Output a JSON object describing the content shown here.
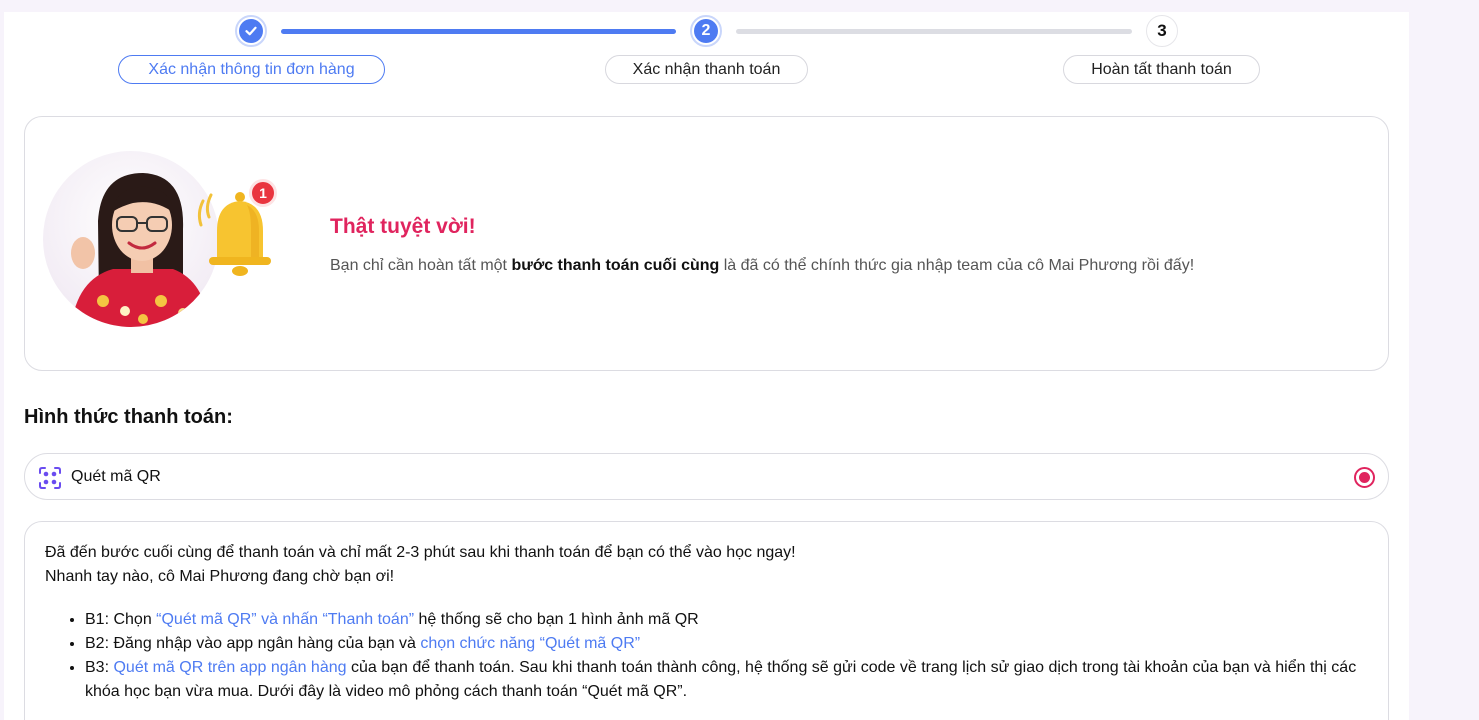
{
  "stepper": {
    "steps": [
      {
        "label": "Xác nhận thông tin đơn hàng",
        "state": "done"
      },
      {
        "label": "Xác nhận thanh toán",
        "number": "2",
        "state": "active"
      },
      {
        "label": "Hoàn tất thanh toán",
        "number": "3",
        "state": "todo"
      }
    ]
  },
  "hero": {
    "title": "Thật tuyệt vời!",
    "text_before": "Bạn chỉ cần hoàn tất một ",
    "text_bold": "bước thanh toán cuối cùng",
    "text_after": " là đã có thể chính thức gia nhập team của cô Mai Phương rồi đấy!",
    "notification_count": "1"
  },
  "payment": {
    "section_title": "Hình thức thanh toán:",
    "method_label": "Quét mã QR",
    "selected": true
  },
  "instructions": {
    "line1": "Đã đến bước cuối cùng để thanh toán và chỉ mất 2-3 phút sau khi thanh toán để bạn có thể vào học ngay!",
    "line2": "Nhanh tay nào, cô Mai Phương đang chờ bạn ơi!",
    "b1_prefix": "B1: Chọn ",
    "b1_highlight": "“Quét mã QR” và nhấn “Thanh toán”",
    "b1_suffix": " hệ thống sẽ cho bạn 1 hình ảnh mã QR",
    "b2_prefix": "B2: Đăng nhập vào app ngân hàng của bạn và ",
    "b2_highlight": "chọn chức năng “Quét mã QR”",
    "b3_prefix": "B3: ",
    "b3_highlight": "Quét mã QR trên app ngân hàng",
    "b3_suffix": " của bạn để thanh toán. Sau khi thanh toán thành công, hệ thống sẽ gửi code về trang lịch sử giao dịch trong tài khoản của bạn và hiển thị các khóa học bạn vừa mua. Dưới đây là video mô phỏng cách thanh toán “Quét mã QR”."
  },
  "colors": {
    "accent_blue": "#4e7bf2",
    "accent_pink": "#e0245e"
  }
}
